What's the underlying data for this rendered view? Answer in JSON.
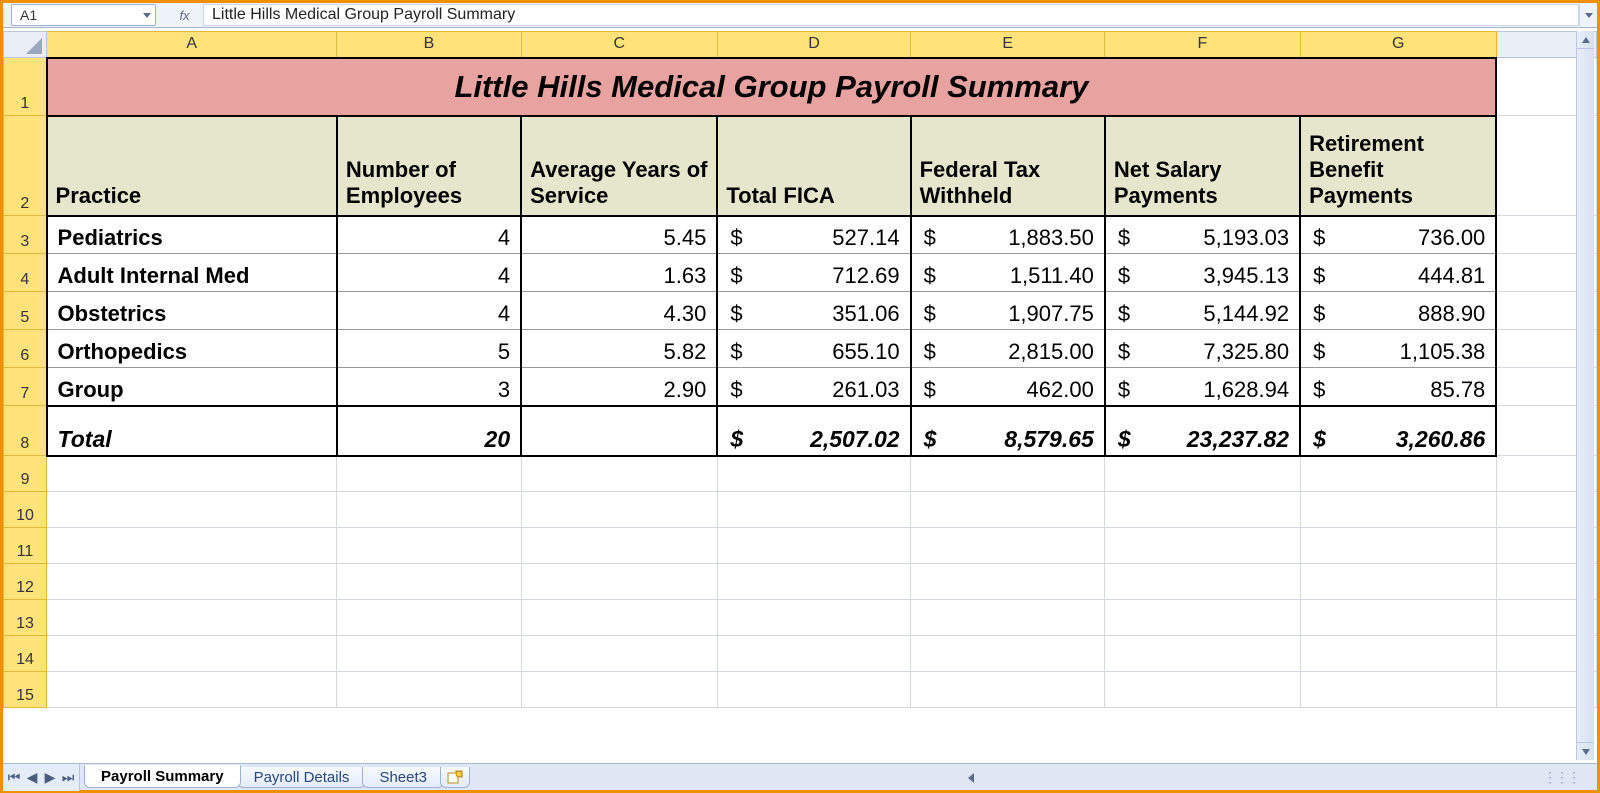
{
  "formula_bar": {
    "name_box": "A1",
    "fx_label": "fx",
    "content": "Little Hills Medical Group Payroll Summary"
  },
  "columns": [
    "A",
    "B",
    "C",
    "D",
    "E",
    "F",
    "G"
  ],
  "rows_visible": [
    "1",
    "2",
    "3",
    "4",
    "5",
    "6",
    "7",
    "8",
    "9",
    "10",
    "11",
    "12",
    "13",
    "14",
    "15"
  ],
  "title": "Little Hills Medical Group Payroll Summary",
  "headers": {
    "practice": "Practice",
    "num_employees": "Number of Employees",
    "avg_years": "Average Years of Service",
    "total_fica": "Total FICA",
    "fed_tax": "Federal Tax Withheld",
    "net_salary": "Net Salary Payments",
    "retirement": "Retirement Benefit Payments"
  },
  "data": [
    {
      "practice": "Pediatrics",
      "num": "4",
      "avg": "5.45",
      "fica": "527.14",
      "fed": "1,883.50",
      "net": "5,193.03",
      "ret": "736.00"
    },
    {
      "practice": "Adult Internal Med",
      "num": "4",
      "avg": "1.63",
      "fica": "712.69",
      "fed": "1,511.40",
      "net": "3,945.13",
      "ret": "444.81"
    },
    {
      "practice": "Obstetrics",
      "num": "4",
      "avg": "4.30",
      "fica": "351.06",
      "fed": "1,907.75",
      "net": "5,144.92",
      "ret": "888.90"
    },
    {
      "practice": "Orthopedics",
      "num": "5",
      "avg": "5.82",
      "fica": "655.10",
      "fed": "2,815.00",
      "net": "7,325.80",
      "ret": "1,105.38"
    },
    {
      "practice": "Group",
      "num": "3",
      "avg": "2.90",
      "fica": "261.03",
      "fed": "462.00",
      "net": "1,628.94",
      "ret": "85.78"
    }
  ],
  "total": {
    "label": "Total",
    "num": "20",
    "avg": "",
    "fica": "2,507.02",
    "fed": "8,579.65",
    "net": "23,237.82",
    "ret": "3,260.86"
  },
  "currency_symbol": "$",
  "tabs": {
    "items": [
      "Payroll Summary",
      "Payroll Details",
      "Sheet3"
    ],
    "active_index": 0
  }
}
